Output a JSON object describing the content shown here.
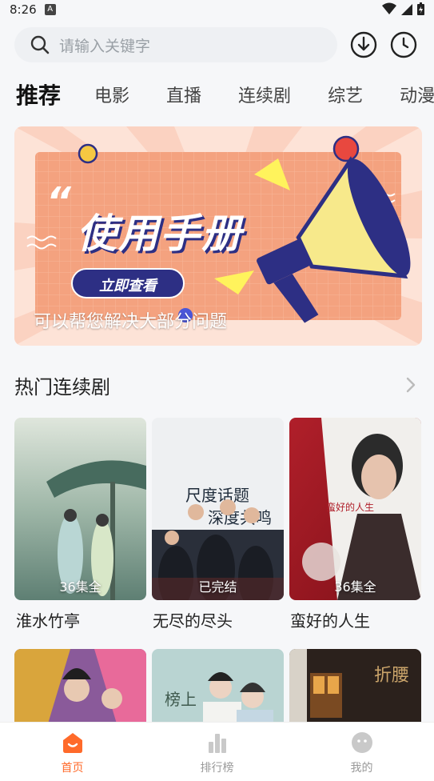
{
  "status_bar": {
    "time": "8:26",
    "notif_letter": "A"
  },
  "search": {
    "placeholder": "请输入关键字"
  },
  "tabs": [
    {
      "label": "推荐",
      "active": true
    },
    {
      "label": "电影"
    },
    {
      "label": "直播"
    },
    {
      "label": "连续剧"
    },
    {
      "label": "综艺"
    },
    {
      "label": "动漫"
    }
  ],
  "banner": {
    "headline": "使用手册",
    "button_label": "立即查看",
    "caption": "可以帮您解决大部分问题"
  },
  "section": {
    "title": "热门连续剧"
  },
  "cards": [
    {
      "title": "淮水竹亭",
      "badge": "36集全"
    },
    {
      "title": "无尽的尽头",
      "badge": "已完结"
    },
    {
      "title": "蛮好的人生",
      "badge": "36集全"
    }
  ],
  "bottom_nav": [
    {
      "label": "首页",
      "icon": "home-icon",
      "active": true
    },
    {
      "label": "排行榜",
      "icon": "chart-icon"
    },
    {
      "label": "我的",
      "icon": "profile-icon"
    }
  ],
  "colors": {
    "accent": "#ff6a2a",
    "banner_bg": "#f4a27f",
    "banner_blue": "#2d2f84"
  }
}
